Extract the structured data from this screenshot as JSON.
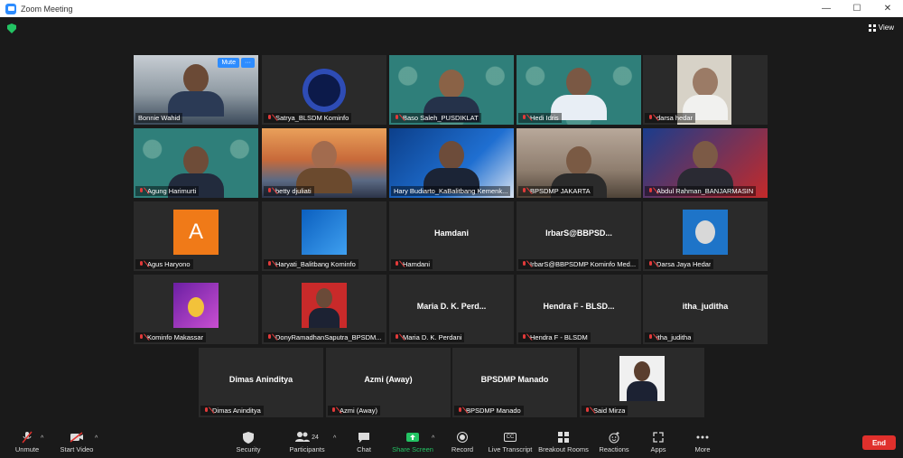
{
  "window": {
    "title": "Zoom Meeting",
    "minimize": "—",
    "maximize": "☐",
    "close": "✕"
  },
  "header": {
    "view_label": "View"
  },
  "active_speaker": {
    "mute_label": "Mute",
    "more_label": "···"
  },
  "participants": [
    {
      "name": "Bonnie Wahid",
      "display": "",
      "muted": false
    },
    {
      "name": "Satrya_BLSDM Kominfo",
      "display": "",
      "muted": true
    },
    {
      "name": "Baso Saleh_PUSDIKLAT",
      "display": "",
      "muted": true
    },
    {
      "name": "Hedi Idris",
      "display": "",
      "muted": true
    },
    {
      "name": "darsa hedar",
      "display": "",
      "muted": true
    },
    {
      "name": "Agung Harimurti",
      "display": "",
      "muted": true
    },
    {
      "name": "betty djuliati",
      "display": "",
      "muted": true
    },
    {
      "name": "Hary Budiarto_KaBalitbang Kemenk...",
      "display": "",
      "muted": false
    },
    {
      "name": "BPSDMP JAKARTA",
      "display": "",
      "muted": true
    },
    {
      "name": "Abdul Rahman_BANJARMASIN",
      "display": "",
      "muted": true
    },
    {
      "name": "Agus Haryono",
      "display": "A",
      "muted": true
    },
    {
      "name": "Haryati_Balitbang Kominfo",
      "display": "",
      "muted": true
    },
    {
      "name": "Hamdani",
      "display": "Hamdani",
      "muted": true
    },
    {
      "name": "IrbarS@BBPSDMP Kominfo Med...",
      "display": "IrbarS@BBPSD...",
      "muted": true
    },
    {
      "name": "Darsa Jaya Hedar",
      "display": "",
      "muted": true
    },
    {
      "name": "Kominfo Makassar",
      "display": "",
      "muted": true
    },
    {
      "name": "DonyRamadhanSaputra_BPSDM...",
      "display": "",
      "muted": true
    },
    {
      "name": "Maria D. K. Perdani",
      "display": "Maria D. K. Perd...",
      "muted": true
    },
    {
      "name": "Hendra F - BLSDM",
      "display": "Hendra F - BLSD...",
      "muted": true
    },
    {
      "name": "itha_juditha",
      "display": "itha_juditha",
      "muted": true
    },
    {
      "name": "Dimas Aninditya",
      "display": "Dimas Aninditya",
      "muted": true
    },
    {
      "name": "Azmi (Away)",
      "display": "Azmi (Away)",
      "muted": true
    },
    {
      "name": "BPSDMP Manado",
      "display": "BPSDMP Manado",
      "muted": true
    },
    {
      "name": "Said Mirza",
      "display": "",
      "muted": true
    }
  ],
  "toolbar": {
    "unmute": "Unmute",
    "start_video": "Start Video",
    "security": "Security",
    "participants": "Participants",
    "participants_count": "24",
    "chat": "Chat",
    "share_screen": "Share Screen",
    "record": "Record",
    "live_transcript": "Live Transcript",
    "live_transcript_icon": "CC",
    "breakout_rooms": "Breakout Rooms",
    "reactions": "Reactions",
    "apps": "Apps",
    "more": "More",
    "end": "End"
  },
  "colors": {
    "accent": "#2d8cff",
    "share": "#23c363",
    "end": "#e0302c",
    "active_border": "#d8e84a"
  }
}
